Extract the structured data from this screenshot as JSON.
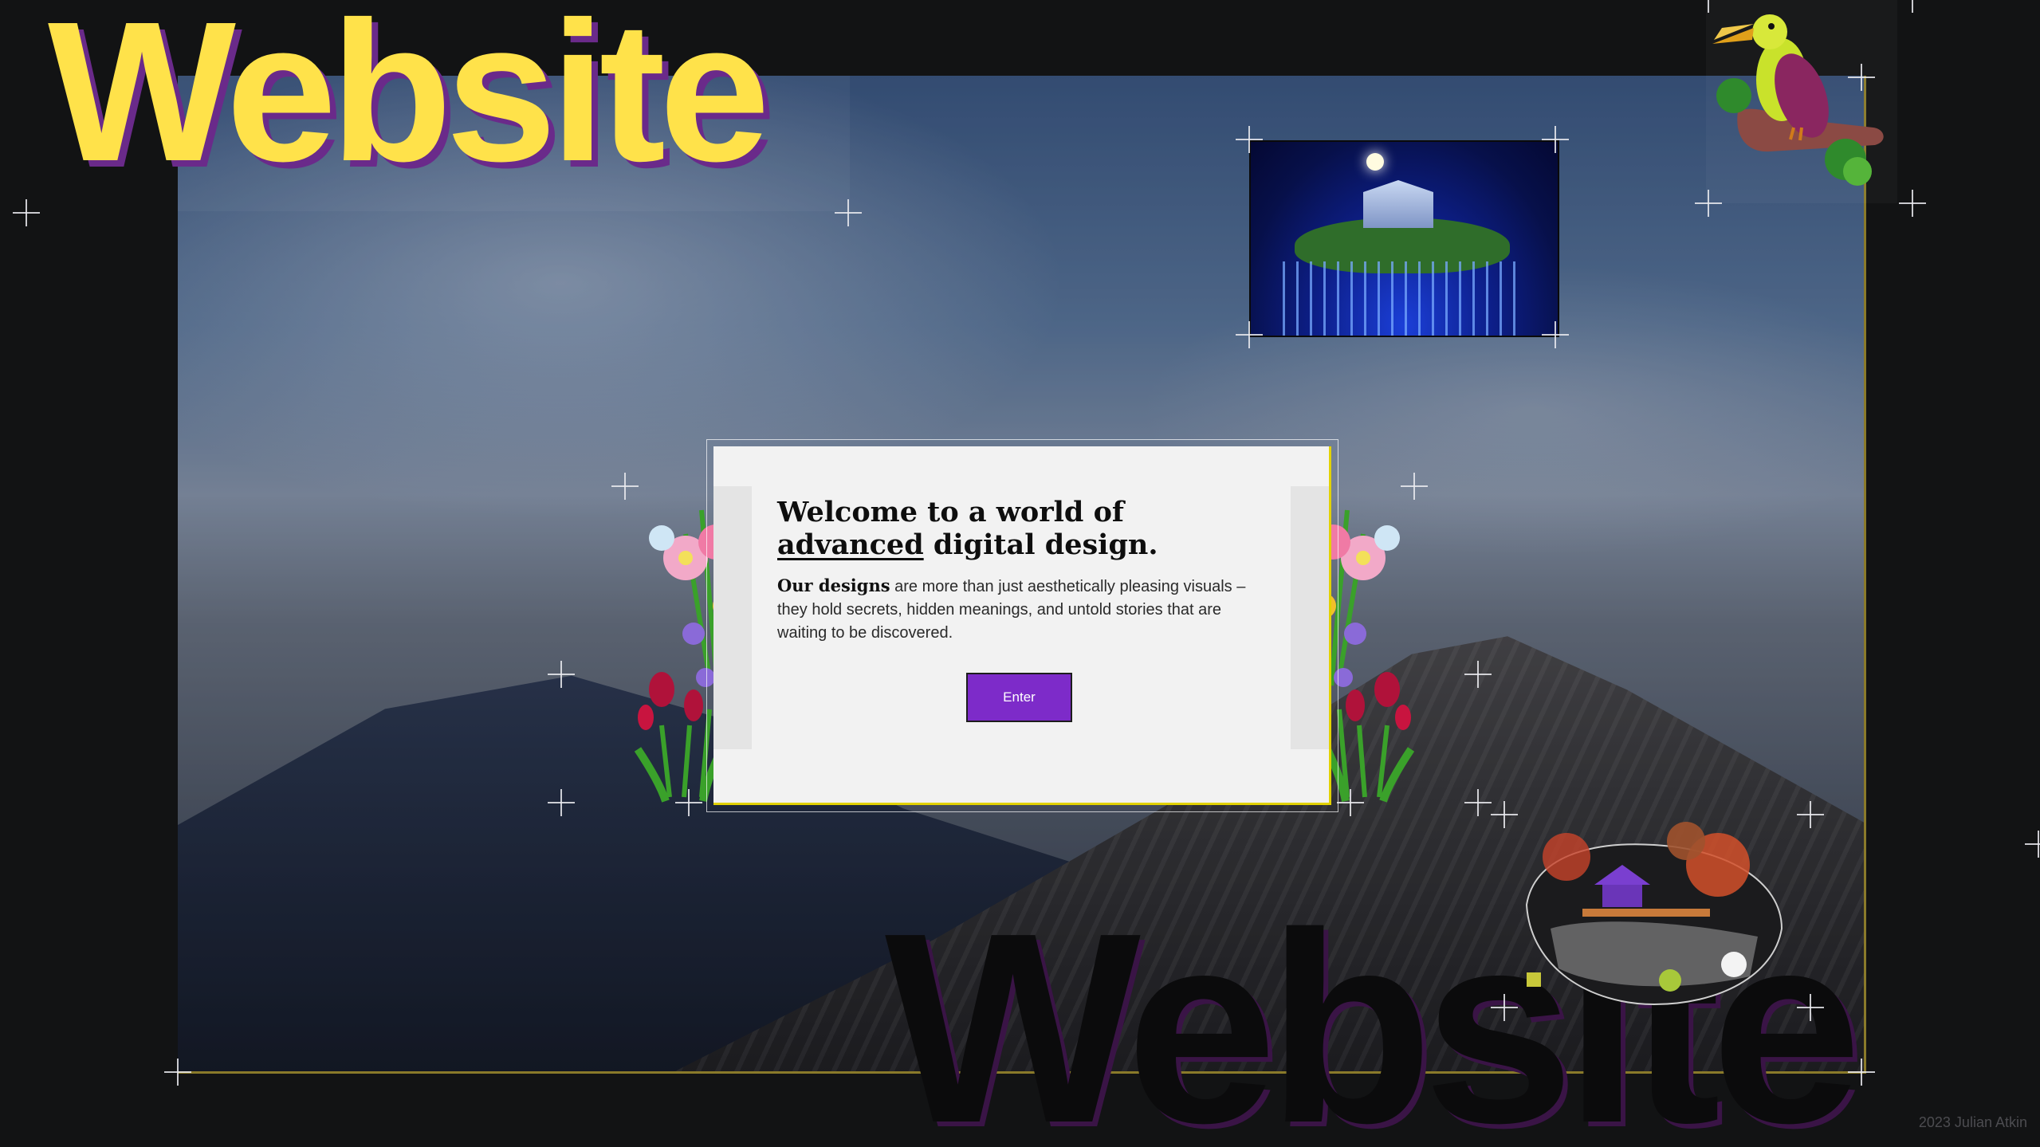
{
  "branding": {
    "title_top": "Website",
    "title_bottom": "Website",
    "credit": "2023 Julian Atkin"
  },
  "dialog": {
    "heading_part1": "Welcome to a world of ",
    "heading_emphasis": "advanced",
    "heading_part2": " digital design.",
    "body_strong": "Our designs",
    "body_rest": " are more than just aesthetically pleasing visuals – they hold secrets, hidden meanings, and untold stories that are waiting to be discovered.",
    "enter_label": "Enter"
  },
  "decorations": {
    "temple_image": "pixel-temple-icon",
    "toucan_image": "pixel-toucan-icon",
    "pagoda_image": "pixel-pagoda-icon",
    "bouquet_image": "pixel-flower-bouquet-icon",
    "crosshair": "crosshair-plus-icon"
  },
  "colors": {
    "title_yellow": "#ffe24a",
    "title_shadow": "#6a2a8a",
    "button_purple": "#7d2bc9",
    "dialog_bg": "#f2f2f2",
    "frame_gold": "#8a7a2a",
    "page_bg": "#121314"
  }
}
